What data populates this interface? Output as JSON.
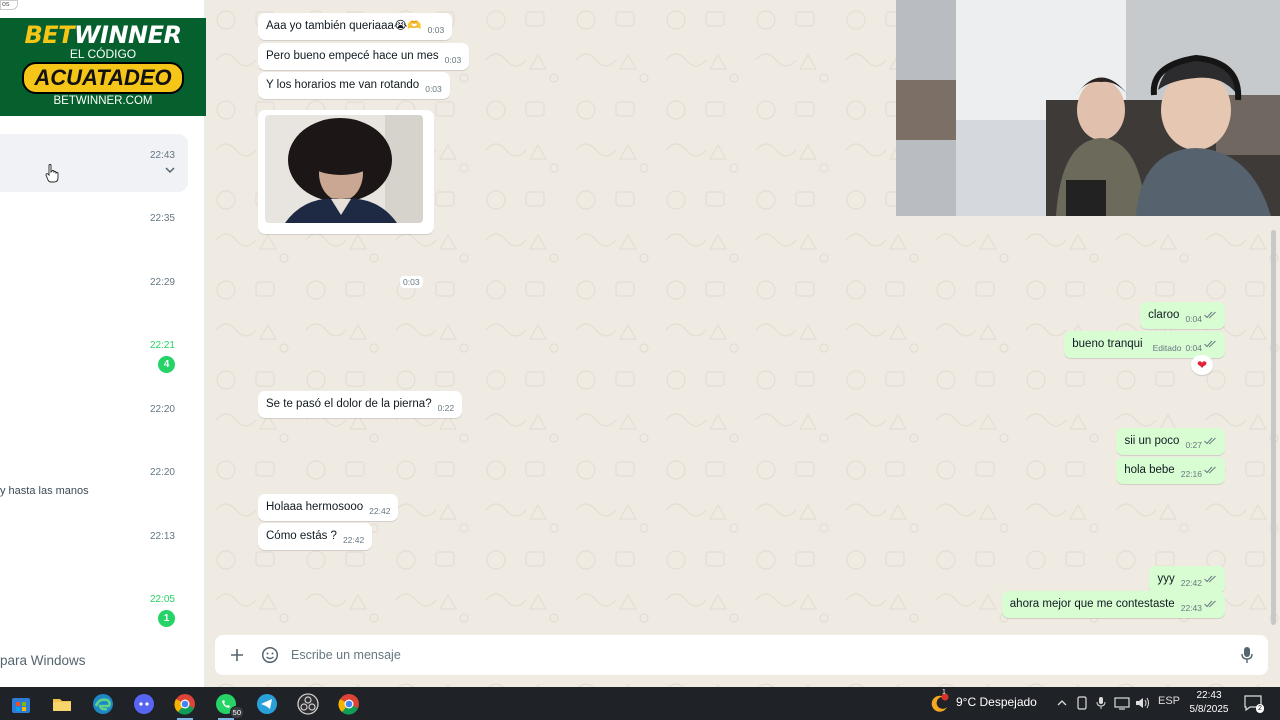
{
  "sidebar": {
    "top_pill": "os",
    "chats": [
      {
        "time": "22:43",
        "unread": false,
        "badge": "",
        "preview": ""
      },
      {
        "time": "22:35",
        "unread": false,
        "badge": "",
        "preview": ""
      },
      {
        "time": "22:29",
        "unread": false,
        "badge": "",
        "preview": ""
      },
      {
        "time": "22:21",
        "unread": true,
        "badge": "4",
        "preview": ""
      },
      {
        "time": "22:20",
        "unread": false,
        "badge": "",
        "preview": ""
      },
      {
        "time": "22:20",
        "unread": false,
        "badge": "",
        "preview": "y hasta las manos"
      },
      {
        "time": "22:13",
        "unread": false,
        "badge": "",
        "preview": ""
      },
      {
        "time": "22:05",
        "unread": true,
        "badge": "1",
        "preview": ""
      }
    ],
    "windows_link": "para Windows"
  },
  "ad": {
    "brand_part1": "BET",
    "brand_part2": "WINNER",
    "code_label": "EL CÓDIGO",
    "code": "ACUATADEO",
    "site": "BETWINNER.COM"
  },
  "conversation": {
    "messages": [
      {
        "dir": "in",
        "text": "Aaa yo también queriaaa😭🫶",
        "time": "0:03",
        "edited": ""
      },
      {
        "dir": "in",
        "text": "Pero bueno empecé hace un mes",
        "time": "0:03",
        "edited": ""
      },
      {
        "dir": "in",
        "text": "Y los horarios me van rotando",
        "time": "0:03",
        "edited": ""
      },
      {
        "dir": "out",
        "text": "claroo",
        "time": "0:04",
        "edited": ""
      },
      {
        "dir": "out",
        "text": "bueno tranqui",
        "time": "0:04",
        "edited": "Editado"
      },
      {
        "dir": "in",
        "text": "Se te pasó el dolor de la pierna?",
        "time": "0:22",
        "edited": ""
      },
      {
        "dir": "out",
        "text": "sii un poco",
        "time": "0:27",
        "edited": ""
      },
      {
        "dir": "out",
        "text": "hola bebe",
        "time": "22:16",
        "edited": ""
      },
      {
        "dir": "in",
        "text": "Holaaa hermosooo",
        "time": "22:42",
        "edited": ""
      },
      {
        "dir": "in",
        "text": "Cómo estás ?",
        "time": "22:42",
        "edited": ""
      },
      {
        "dir": "out",
        "text": "yyy",
        "time": "22:42",
        "edited": ""
      },
      {
        "dir": "out",
        "text": "ahora mejor que me contestaste",
        "time": "22:43",
        "edited": ""
      }
    ],
    "lone_time": "0:03",
    "reaction": "❤"
  },
  "composer": {
    "placeholder": "Escribe un mensaje"
  },
  "taskbar": {
    "apps": [
      {
        "name": "store-icon",
        "badge": ""
      },
      {
        "name": "file-explorer-icon",
        "badge": ""
      },
      {
        "name": "edge-icon",
        "badge": ""
      },
      {
        "name": "discord-icon",
        "badge": ""
      },
      {
        "name": "chrome-icon",
        "badge": ""
      },
      {
        "name": "whatsapp-icon",
        "badge": "50"
      },
      {
        "name": "telegram-icon",
        "badge": ""
      },
      {
        "name": "obs-icon",
        "badge": ""
      },
      {
        "name": "chrome-alt-icon",
        "badge": ""
      }
    ],
    "weather": "9°C  Despejado",
    "weather_alert": "1",
    "language": "ESP",
    "time": "22:43",
    "date": "5/8/2025",
    "notifications": "2"
  },
  "colors": {
    "accent_green": "#25d366",
    "outgoing_bubble": "#d9fdd3",
    "chat_background": "#efeae2",
    "ad_green": "#06602d",
    "ad_yellow": "#f5c518"
  }
}
